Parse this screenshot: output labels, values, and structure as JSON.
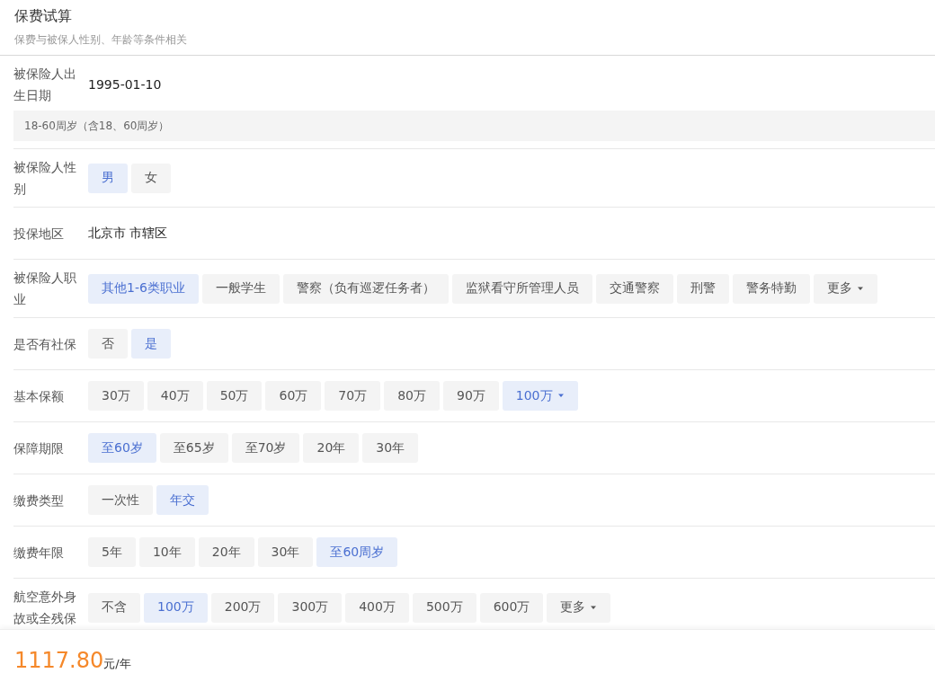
{
  "header": {
    "title": "保费试算",
    "subtitle": "保费与被保人性别、年龄等条件相关"
  },
  "fields": [
    {
      "kind": "date",
      "label": "被保险人出生日期",
      "value": "1995-01-10",
      "note": "18-60周岁（含18、60周岁）"
    },
    {
      "kind": "choice",
      "label": "被保险人性别",
      "options": [
        {
          "label": "男",
          "selected": true,
          "menu": false
        },
        {
          "label": "女",
          "selected": false,
          "menu": false
        }
      ]
    },
    {
      "kind": "text",
      "label": "投保地区",
      "value": "北京市 市辖区"
    },
    {
      "kind": "choice",
      "label": "被保险人职业",
      "options": [
        {
          "label": "其他1-6类职业",
          "selected": true,
          "menu": false
        },
        {
          "label": "一般学生",
          "selected": false,
          "menu": false
        },
        {
          "label": "警察（负有巡逻任务者）",
          "selected": false,
          "menu": false
        },
        {
          "label": "监狱看守所管理人员",
          "selected": false,
          "menu": false
        },
        {
          "label": "交通警察",
          "selected": false,
          "menu": false
        },
        {
          "label": "刑警",
          "selected": false,
          "menu": false
        },
        {
          "label": "警务特勤",
          "selected": false,
          "menu": false
        },
        {
          "label": "更多",
          "selected": false,
          "menu": true
        }
      ]
    },
    {
      "kind": "choice",
      "label": "是否有社保",
      "options": [
        {
          "label": "否",
          "selected": false,
          "menu": false
        },
        {
          "label": "是",
          "selected": true,
          "menu": false
        }
      ]
    },
    {
      "kind": "choice",
      "label": "基本保额",
      "options": [
        {
          "label": "30万",
          "selected": false,
          "menu": false
        },
        {
          "label": "40万",
          "selected": false,
          "menu": false
        },
        {
          "label": "50万",
          "selected": false,
          "menu": false
        },
        {
          "label": "60万",
          "selected": false,
          "menu": false
        },
        {
          "label": "70万",
          "selected": false,
          "menu": false
        },
        {
          "label": "80万",
          "selected": false,
          "menu": false
        },
        {
          "label": "90万",
          "selected": false,
          "menu": false
        },
        {
          "label": "100万",
          "selected": true,
          "menu": true
        }
      ]
    },
    {
      "kind": "choice",
      "label": "保障期限",
      "options": [
        {
          "label": "至60岁",
          "selected": true,
          "menu": false
        },
        {
          "label": "至65岁",
          "selected": false,
          "menu": false
        },
        {
          "label": "至70岁",
          "selected": false,
          "menu": false
        },
        {
          "label": "20年",
          "selected": false,
          "menu": false
        },
        {
          "label": "30年",
          "selected": false,
          "menu": false
        }
      ]
    },
    {
      "kind": "choice",
      "label": "缴费类型",
      "options": [
        {
          "label": "一次性",
          "selected": false,
          "menu": false
        },
        {
          "label": "年交",
          "selected": true,
          "menu": false
        }
      ]
    },
    {
      "kind": "choice",
      "label": "缴费年限",
      "options": [
        {
          "label": "5年",
          "selected": false,
          "menu": false
        },
        {
          "label": "10年",
          "selected": false,
          "menu": false
        },
        {
          "label": "20年",
          "selected": false,
          "menu": false
        },
        {
          "label": "30年",
          "selected": false,
          "menu": false
        },
        {
          "label": "至60周岁",
          "selected": true,
          "menu": false
        }
      ]
    },
    {
      "kind": "choice",
      "label": "航空意外身故或全残保",
      "options": [
        {
          "label": "不含",
          "selected": false,
          "menu": false
        },
        {
          "label": "100万",
          "selected": true,
          "menu": false
        },
        {
          "label": "200万",
          "selected": false,
          "menu": false
        },
        {
          "label": "300万",
          "selected": false,
          "menu": false
        },
        {
          "label": "400万",
          "selected": false,
          "menu": false
        },
        {
          "label": "500万",
          "selected": false,
          "menu": false
        },
        {
          "label": "600万",
          "selected": false,
          "menu": false
        },
        {
          "label": "更多",
          "selected": false,
          "menu": true
        }
      ]
    }
  ],
  "footer": {
    "price": "1117.80",
    "unit": "元/年"
  }
}
